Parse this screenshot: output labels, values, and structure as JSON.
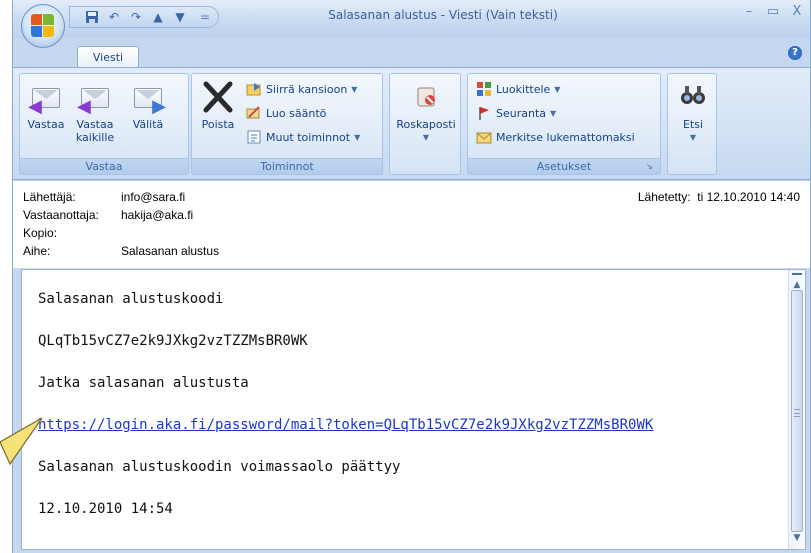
{
  "window": {
    "title": "Salasanan alustus - Viesti (Vain teksti)"
  },
  "qat": {
    "sep": "="
  },
  "tabs": [
    {
      "label": "Viesti",
      "active": true
    }
  ],
  "ribbon": {
    "groups": {
      "vastaa": {
        "label": "Vastaa",
        "buttons": {
          "reply": "Vastaa",
          "reply_all_1": "Vastaa",
          "reply_all_2": "kaikille",
          "forward": "Välitä"
        }
      },
      "toiminnot": {
        "label": "Toiminnot",
        "delete": "Poista",
        "move": "Siirrä kansioon",
        "rule": "Luo sääntö",
        "other": "Muut toiminnot"
      },
      "junk": {
        "label": "Roskaposti"
      },
      "asetukset": {
        "label": "Asetukset",
        "categorize": "Luokittele",
        "follow": "Seuranta",
        "mark_unread": "Merkitse lukemattomaksi"
      },
      "etsi": {
        "label": "Etsi"
      }
    }
  },
  "header": {
    "from_label": "Lähettäjä:",
    "from": "info@sara.fi",
    "to_label": "Vastaanottaja:",
    "to": "hakija@aka.fi",
    "cc_label": "Kopio:",
    "cc": "",
    "subject_label": "Aihe:",
    "subject": "Salasanan alustus",
    "sent_label": "Lähetetty:",
    "sent": "ti 12.10.2010 14:40"
  },
  "body": {
    "line1": "Salasanan alustuskoodi",
    "code": "QLqTb15vCZ7e2k9JXkg2vzTZZMsBR0WK",
    "line3": "Jatka salasanan alustusta",
    "link": "https://login.aka.fi/password/mail?token=QLqTb15vCZ7e2k9JXkg2vzTZZMsBR0WK",
    "line5": "Salasanan alustuskoodin voimassaolo päättyy",
    "expiry": "12.10.2010 14:54"
  },
  "colors": {
    "ribbon_bg": "#d2e1f4",
    "link": "#1a38c8",
    "callout": "#f6e27a"
  }
}
